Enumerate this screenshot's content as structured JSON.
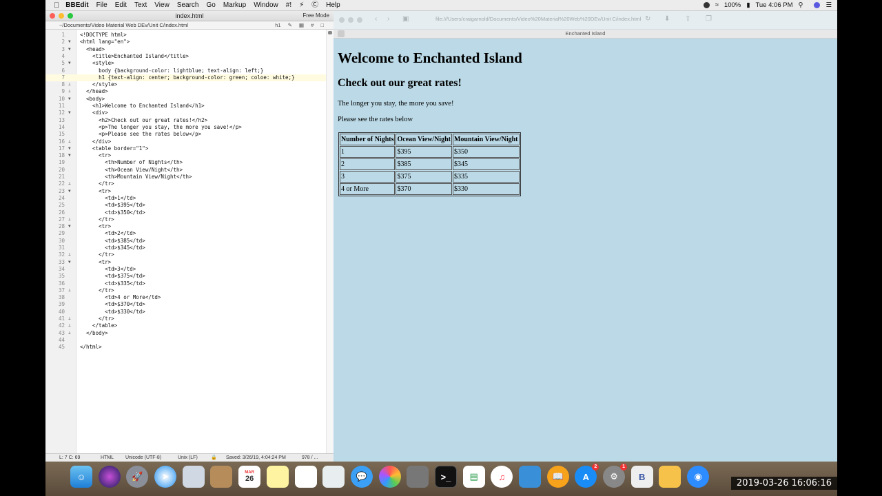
{
  "menubar": {
    "app_name": "BBEdit",
    "items": [
      "File",
      "Edit",
      "Text",
      "View",
      "Search",
      "Go",
      "Markup",
      "Window",
      "#!",
      "Help"
    ],
    "battery": "100%",
    "clock": "Tue 4:06 PM"
  },
  "editor": {
    "title": "index.html",
    "mode": "Free Mode",
    "path": "~/Documents/Video Material Web DEv/Unit C/index.html",
    "tag_menu": "h1",
    "lines": [
      "<!DOCTYPE html>",
      "<html lang=\"en\">",
      "  <head>",
      "    <title>Enchanted Island</title>",
      "    <style>",
      "      body {background-color: lightblue; text-align: left;}",
      "      h1 {text-align: center; background-color: green; coloe: white;}",
      "    </style>",
      "  </head>",
      "  <body>",
      "    <h1>Welcome to Enchanted Island</h1>",
      "    <div>",
      "      <h2>Check out our great rates!</h2>",
      "      <p>The longer you stay, the more you save!</p>",
      "      <p>Please see the rates below</p>",
      "    </div>",
      "    <table border=\"1\">",
      "      <tr>",
      "        <th>Number of Nights</th>",
      "        <th>Ocean View/Night</th>",
      "        <th>Mountain View/Night</th>",
      "      </tr>",
      "      <tr>",
      "        <td>1</td>",
      "        <td>$395</td>",
      "        <td>$350</td>",
      "      </tr>",
      "      <tr>",
      "        <td>2</td>",
      "        <td>$385</td>",
      "        <td>$345</td>",
      "      </tr>",
      "      <tr>",
      "        <td>3</td>",
      "        <td>$375</td>",
      "        <td>$335</td>",
      "      </tr>",
      "        <td>4 or More</td>",
      "        <td>$370</td>",
      "        <td>$330</td>",
      "      </tr>",
      "    </table>",
      "  </body>",
      "",
      "</html>"
    ],
    "status": {
      "cursor": "L: 7 C: 69",
      "language": "HTML",
      "encoding": "Unicode (UTF-8)",
      "line_endings": "Unix (LF)",
      "saved": "Saved: 3/26/19, 4:04:24 PM",
      "size": "978 / ..."
    }
  },
  "browser": {
    "url": "file:///Users/craigarnold/Documents/Video%20Material%20Web%20DEv/Unit C/index.html",
    "tab_title": "Enchanted Island",
    "page": {
      "h1": "Welcome to Enchanted Island",
      "h2": "Check out our great rates!",
      "p1": "The longer you stay, the more you save!",
      "p2": "Please see the rates below",
      "table_headers": [
        "Number of Nights",
        "Ocean View/Night",
        "Mountain View/Night"
      ],
      "table_rows": [
        [
          "1",
          "$395",
          "$350"
        ],
        [
          "2",
          "$385",
          "$345"
        ],
        [
          "3",
          "$375",
          "$335"
        ],
        [
          "4 or More",
          "$370",
          "$330"
        ]
      ]
    }
  },
  "dock": {
    "calendar_month": "MAR",
    "calendar_day": "26",
    "app_store_badge": "2",
    "settings_badge": "1"
  },
  "video_timestamp": "2019-03-26  16:06:16"
}
